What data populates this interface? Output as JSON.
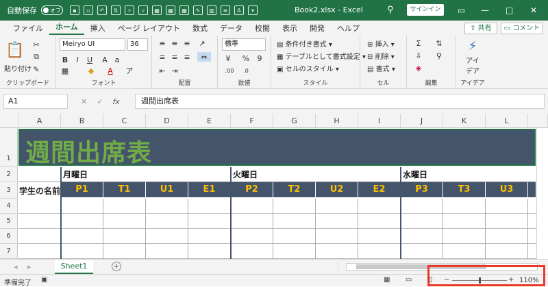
{
  "titlebar": {
    "autosave_label": "自動保存",
    "autosave_state": "オフ",
    "filename": "Book2.xlsx  -  Excel",
    "signin": "サインイン",
    "minimize": "—",
    "restore": "□",
    "close": "✕"
  },
  "menu": {
    "items": [
      "ファイル",
      "ホーム",
      "挿入",
      "ページ レイアウト",
      "数式",
      "データ",
      "校閲",
      "表示",
      "開発",
      "ヘルプ"
    ],
    "active_index": 1,
    "share": "共有",
    "comment": "コメント"
  },
  "ribbon": {
    "clipboard": {
      "paste": "貼り付け",
      "label": "クリップボード"
    },
    "font": {
      "name": "Meiryo UI",
      "size": "36",
      "label": "フォント"
    },
    "alignment": {
      "label": "配置"
    },
    "number": {
      "format": "標準",
      "label": "数値"
    },
    "styles": {
      "conditional": "条件付き書式",
      "table": "テーブルとして書式設定",
      "cell_styles": "セルのスタイル",
      "label": "スタイル"
    },
    "cells": {
      "insert": "挿入",
      "delete": "削除",
      "format": "書式",
      "label": "セル"
    },
    "editing": {
      "label": "編集"
    },
    "ideas": {
      "button": "アイ\nデア",
      "label": "アイデア"
    }
  },
  "formula_bar": {
    "name_box": "A1",
    "content": "週間出席表"
  },
  "grid": {
    "columns": [
      "A",
      "B",
      "C",
      "D",
      "E",
      "F",
      "G",
      "H",
      "I",
      "J",
      "K",
      "L"
    ],
    "rows": [
      "1",
      "2",
      "3",
      "4",
      "5",
      "6",
      "7"
    ],
    "title": "週間出席表",
    "days": [
      "月曜日",
      "火曜日",
      "水曜日"
    ],
    "student_header": "学生の名前",
    "periods": [
      "P1",
      "T1",
      "U1",
      "E1",
      "P2",
      "T2",
      "U2",
      "E2",
      "P3",
      "T3",
      "U3"
    ]
  },
  "sheets": {
    "tabs": [
      "Sheet1"
    ]
  },
  "status": {
    "ready": "準備完了",
    "zoom": "110%"
  },
  "colors": {
    "excel_green": "#217346",
    "header_navy": "#44546a",
    "title_green": "#70ad47",
    "period_gold": "#ffc000",
    "highlight_red": "#e8392b"
  }
}
